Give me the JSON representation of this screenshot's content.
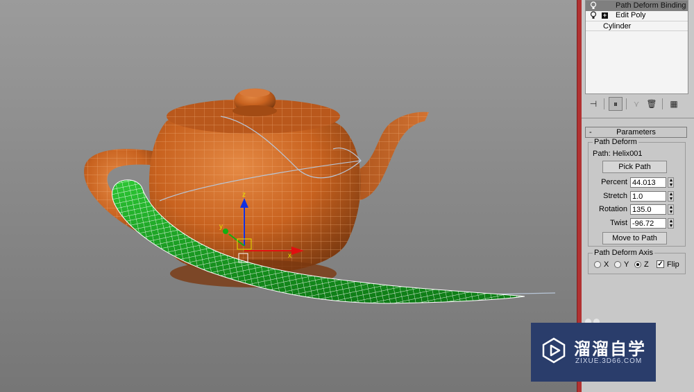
{
  "modifier_stack": {
    "items": [
      {
        "label": "Path Deform Binding (WS)",
        "selected": true,
        "has_expand": false,
        "has_bulb": true
      },
      {
        "label": "Edit Poly",
        "selected": false,
        "has_expand": true,
        "has_bulb": true
      },
      {
        "label": "Cylinder",
        "selected": false,
        "has_expand": false,
        "has_bulb": false
      }
    ]
  },
  "toolbar": {
    "icons": [
      "pin-stack-icon",
      "show-end-result-icon",
      "make-unique-icon",
      "remove-modifier-icon",
      "configure-modifier-sets-icon"
    ]
  },
  "parameters": {
    "rollout_title": "Parameters",
    "collapse_symbol": "-",
    "path_deform_group": "Path Deform",
    "path_label": "Path: Helix001",
    "pick_path_label": "Pick Path",
    "fields": [
      {
        "label": "Percent",
        "value": "44.013"
      },
      {
        "label": "Stretch",
        "value": "1.0"
      },
      {
        "label": "Rotation",
        "value": "135.0"
      },
      {
        "label": "Twist",
        "value": "-96.72"
      }
    ],
    "move_to_path_label": "Move to Path",
    "axis_group": "Path Deform Axis",
    "axis_options": [
      {
        "label": "X",
        "selected": false
      },
      {
        "label": "Y",
        "selected": false
      },
      {
        "label": "Z",
        "selected": true
      }
    ],
    "flip_label": "Flip",
    "flip_checked": true
  },
  "viewport": {
    "gizmo_axes": {
      "x": "x",
      "y": "y",
      "z": "z"
    },
    "colors": {
      "teapot": "#c8621f",
      "deformed_cylinder": "#169a1e",
      "axis_x": "#e01010",
      "axis_y": "#12b012",
      "axis_z": "#1030e0",
      "path": "#b8c6d8"
    }
  },
  "watermark": {
    "title": "溜溜自学",
    "url": "ZIXUE.3D66.COM"
  },
  "colors": {
    "panel_bg": "#c8c8c8",
    "divider": "#b13131",
    "selected_row": "#7f7f7f",
    "watermark_bg": "#2a3d6b"
  }
}
